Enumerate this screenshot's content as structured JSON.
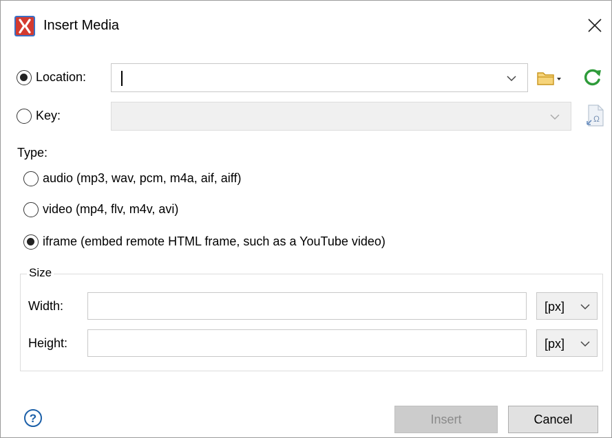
{
  "window": {
    "title": "Insert Media"
  },
  "source": {
    "location_label": "Location:",
    "location_value": "",
    "location_selected": true,
    "key_label": "Key:",
    "key_value": "",
    "key_selected": false
  },
  "type": {
    "label": "Type:",
    "options": [
      {
        "label": "audio (mp3, wav, pcm, m4a, aif, aiff)",
        "selected": false
      },
      {
        "label": "video (mp4, flv, m4v, avi)",
        "selected": false
      },
      {
        "label": "iframe (embed remote HTML frame, such as a YouTube video)",
        "selected": true
      }
    ]
  },
  "size": {
    "group_label": "Size",
    "width_label": "Width:",
    "width_value": "",
    "width_unit": "[px]",
    "height_label": "Height:",
    "height_value": "",
    "height_unit": "[px]"
  },
  "footer": {
    "insert_label": "Insert",
    "cancel_label": "Cancel"
  },
  "icons": {
    "app": "oxygen-x-icon",
    "close": "close-icon",
    "browse": "folder-icon",
    "refresh": "refresh-icon",
    "key_browse": "key-reference-icon",
    "help": "help-icon"
  },
  "colors": {
    "app_icon_bg": "#d43a2f",
    "folder": "#e6b22e",
    "refresh": "#2e9b3a",
    "help": "#1b5fa8"
  }
}
